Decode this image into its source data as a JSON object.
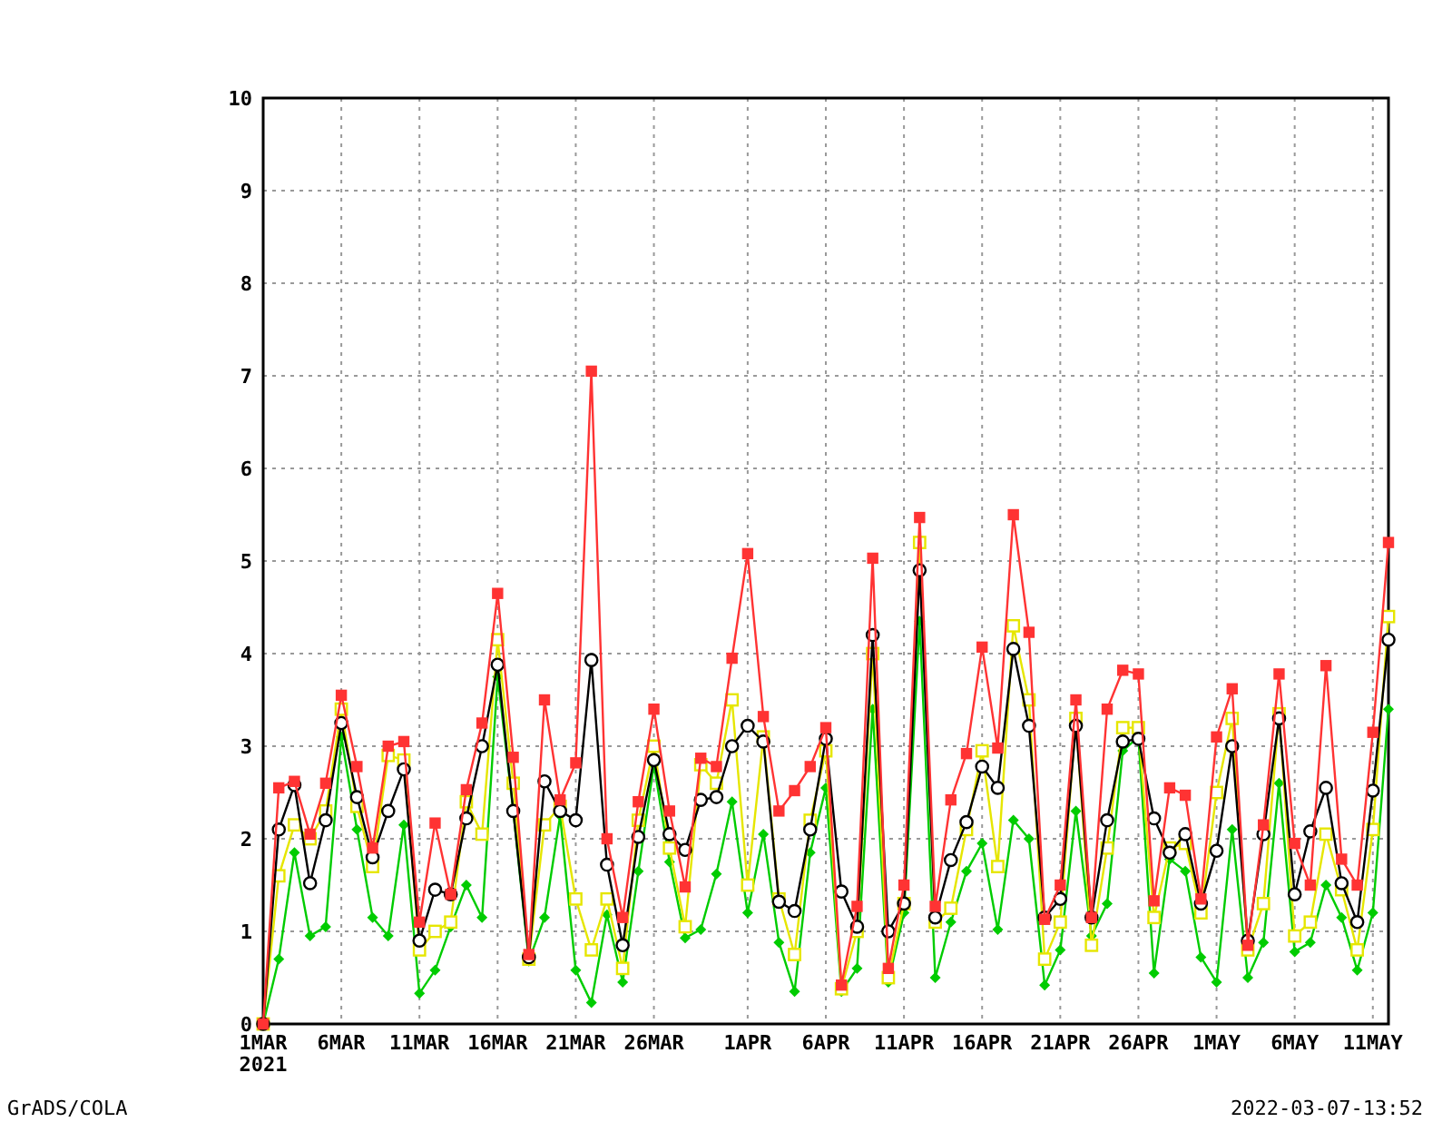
{
  "chart_data": {
    "type": "line",
    "categories": [
      "1MAR",
      null,
      null,
      null,
      null,
      "6MAR",
      null,
      null,
      null,
      null,
      "11MAR",
      null,
      null,
      null,
      null,
      "16MAR",
      null,
      null,
      null,
      null,
      "21MAR",
      null,
      null,
      null,
      null,
      "26MAR",
      null,
      null,
      null,
      null,
      null,
      "1APR",
      null,
      null,
      null,
      null,
      "6APR",
      null,
      null,
      null,
      null,
      "11APR",
      null,
      null,
      null,
      null,
      "16APR",
      null,
      null,
      null,
      null,
      "21APR",
      null,
      null,
      null,
      null,
      "26APR",
      null,
      null,
      null,
      null,
      "1MAY",
      null,
      null,
      null,
      null,
      "6MAY",
      null,
      null,
      null,
      null,
      "11MAY",
      null
    ],
    "ylim": [
      0,
      10
    ],
    "grid": true,
    "yticks": [
      0,
      1,
      2,
      3,
      4,
      5,
      6,
      7,
      8,
      9,
      10
    ],
    "series": [
      {
        "color": "#00cc00",
        "marker": "diamond",
        "values": [
          0,
          0.7,
          1.85,
          0.95,
          1.05,
          3.1,
          2.1,
          1.15,
          0.95,
          2.15,
          0.33,
          0.58,
          1.05,
          1.5,
          1.15,
          3.75,
          2.3,
          0.68,
          1.15,
          2.25,
          0.58,
          0.23,
          1.18,
          0.45,
          1.65,
          2.8,
          1.75,
          0.93,
          1.02,
          1.62,
          2.4,
          1.2,
          2.05,
          0.88,
          0.35,
          1.85,
          2.55,
          0.35,
          0.6,
          3.4,
          0.45,
          1.2,
          4.35,
          0.5,
          1.1,
          1.65,
          1.95,
          1.02,
          2.2,
          2.0,
          0.42,
          0.8,
          2.3,
          0.95,
          1.3,
          2.95,
          3.1,
          0.55,
          1.78,
          1.65,
          0.72,
          0.45,
          2.1,
          0.5,
          0.88,
          2.6,
          0.78,
          0.88,
          1.5,
          1.15,
          0.58,
          1.2,
          3.4
        ]
      },
      {
        "color": "#e6e600",
        "marker": "square",
        "values": [
          0,
          1.6,
          2.15,
          2.0,
          2.3,
          3.4,
          2.35,
          1.7,
          2.9,
          2.85,
          0.8,
          1.0,
          1.1,
          2.4,
          2.05,
          4.15,
          2.6,
          0.7,
          2.15,
          2.35,
          1.35,
          0.8,
          1.35,
          0.6,
          2.2,
          3.0,
          1.9,
          1.05,
          2.8,
          2.6,
          3.5,
          1.5,
          3.1,
          1.35,
          0.75,
          2.2,
          2.95,
          0.38,
          1.0,
          4.0,
          0.5,
          1.3,
          5.2,
          1.1,
          1.25,
          2.1,
          2.95,
          1.7,
          4.3,
          3.5,
          0.7,
          1.1,
          3.3,
          0.85,
          1.9,
          3.2,
          3.2,
          1.15,
          1.9,
          1.95,
          1.2,
          2.5,
          3.3,
          0.8,
          1.3,
          3.35,
          0.95,
          1.1,
          2.05,
          1.45,
          0.8,
          2.1,
          4.4
        ]
      },
      {
        "color": "#000000",
        "marker": "circle",
        "values": [
          0,
          2.1,
          2.58,
          1.52,
          2.2,
          3.25,
          2.45,
          1.8,
          2.3,
          2.75,
          0.9,
          1.45,
          1.4,
          2.22,
          3.0,
          3.88,
          2.3,
          0.72,
          2.62,
          2.3,
          2.2,
          3.93,
          1.72,
          0.85,
          2.02,
          2.85,
          2.05,
          1.88,
          2.42,
          2.45,
          3.0,
          3.22,
          3.05,
          1.32,
          1.22,
          2.1,
          3.08,
          1.43,
          1.05,
          4.2,
          1.0,
          1.3,
          4.9,
          1.15,
          1.77,
          2.18,
          2.78,
          2.55,
          4.05,
          3.22,
          1.15,
          1.35,
          3.22,
          1.15,
          2.2,
          3.05,
          3.08,
          2.22,
          1.85,
          2.05,
          1.3,
          1.87,
          3.0,
          0.9,
          2.05,
          3.3,
          1.4,
          2.08,
          2.55,
          1.52,
          1.1,
          2.52,
          4.15
        ]
      },
      {
        "color": "#ff3333",
        "marker": "square",
        "values": [
          0,
          2.55,
          2.62,
          2.05,
          2.6,
          3.55,
          2.78,
          1.9,
          3.0,
          3.05,
          1.1,
          2.17,
          1.4,
          2.53,
          3.25,
          4.65,
          2.88,
          0.75,
          3.5,
          2.42,
          2.82,
          7.05,
          2.0,
          1.15,
          2.4,
          3.4,
          2.3,
          1.48,
          2.87,
          2.78,
          3.95,
          5.08,
          3.32,
          2.3,
          2.52,
          2.78,
          3.2,
          0.42,
          1.27,
          5.03,
          0.6,
          1.5,
          5.47,
          1.27,
          2.42,
          2.92,
          4.07,
          2.98,
          5.5,
          4.23,
          1.13,
          1.5,
          3.5,
          1.15,
          3.4,
          3.82,
          3.78,
          1.33,
          2.55,
          2.47,
          1.35,
          3.1,
          3.62,
          0.85,
          2.15,
          3.78,
          1.95,
          1.5,
          3.87,
          1.78,
          1.5,
          3.15,
          5.2
        ]
      }
    ]
  },
  "marker_fills": [
    {
      "filled": true
    },
    {
      "filled": false
    },
    {
      "filled": false
    },
    {
      "filled": true
    }
  ],
  "year_label": "2021",
  "footer_left": "GrADS/COLA",
  "footer_right": "2022-03-07-13:52"
}
